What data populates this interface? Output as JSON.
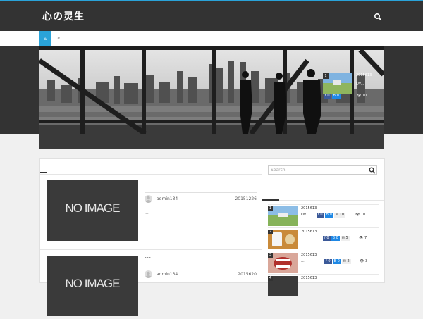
{
  "site": {
    "logo_text": "心の灵生",
    "accent_color": "#2aa3d9",
    "header_color": "#333333"
  },
  "header": {
    "search_icon": "search-icon"
  },
  "nav": {
    "home_icon": "home-icon",
    "home_label": "⌂",
    "separator": "»"
  },
  "slider": {
    "card": {
      "number": "1",
      "date": "2015613",
      "title": "DV...",
      "fb_count": "0",
      "hb_count": "0",
      "views": "10"
    }
  },
  "main": {
    "posts": [
      {
        "thumb_text": "NO IMAGE",
        "title": "",
        "author": "admin134",
        "date": "20151226",
        "excerpt": "..."
      },
      {
        "thumb_text": "NO IMAGE",
        "title": "...",
        "author": "admin134",
        "date": "2015620",
        "excerpt": ""
      }
    ]
  },
  "sidebar": {
    "search_placeholder": "Search",
    "popular": [
      {
        "number": "1",
        "date": "2015613",
        "title": "DV...",
        "fb": "0",
        "hb": "0",
        "comments": "10",
        "views": "10"
      },
      {
        "number": "2",
        "date": "2015613",
        "title": "",
        "fb": "0",
        "hb": "0",
        "comments": "5",
        "views": "7"
      },
      {
        "number": "3",
        "date": "2015613",
        "title": "...",
        "fb": "0",
        "hb": "0",
        "comments": "2",
        "views": "3"
      },
      {
        "number": "4",
        "date": "2015613",
        "title": "",
        "fb": "",
        "hb": "",
        "comments": "",
        "views": ""
      }
    ]
  }
}
